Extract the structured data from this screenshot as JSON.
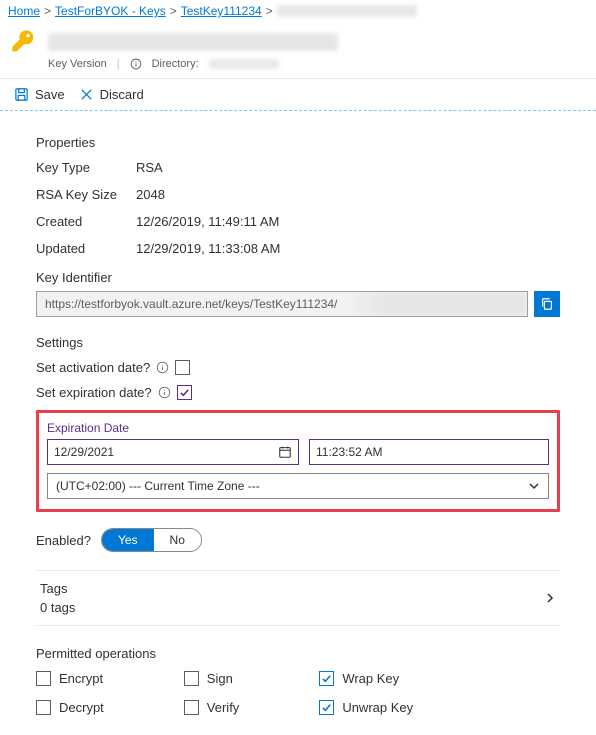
{
  "breadcrumb": {
    "home": "Home",
    "vault": "TestForBYOK - Keys",
    "key": "TestKey111234"
  },
  "header": {
    "subtitle": "Key Version",
    "directory_label": "Directory:"
  },
  "toolbar": {
    "save": "Save",
    "discard": "Discard"
  },
  "properties": {
    "heading": "Properties",
    "key_type_label": "Key Type",
    "key_type": "RSA",
    "rsa_size_label": "RSA Key Size",
    "rsa_size": "2048",
    "created_label": "Created",
    "created": "12/26/2019, 11:49:11 AM",
    "updated_label": "Updated",
    "updated": "12/29/2019, 11:33:08 AM",
    "identifier_label": "Key Identifier",
    "identifier": "https://testforbyok.vault.azure.net/keys/TestKey111234/"
  },
  "settings": {
    "heading": "Settings",
    "activation_label": "Set activation date?",
    "activation_checked": false,
    "expiration_label": "Set expiration date?",
    "expiration_checked": true,
    "exp_section": {
      "label": "Expiration Date",
      "date": "12/29/2021",
      "time": "11:23:52 AM",
      "timezone": "(UTC+02:00) --- Current Time Zone ---"
    },
    "enabled_label": "Enabled?",
    "enabled_yes": "Yes",
    "enabled_no": "No",
    "enabled_value": true
  },
  "tags": {
    "label": "Tags",
    "count_text": "0 tags"
  },
  "permitted": {
    "heading": "Permitted operations",
    "ops": {
      "encrypt": {
        "label": "Encrypt",
        "checked": false
      },
      "decrypt": {
        "label": "Decrypt",
        "checked": false
      },
      "sign": {
        "label": "Sign",
        "checked": false
      },
      "verify": {
        "label": "Verify",
        "checked": false
      },
      "wrap": {
        "label": "Wrap Key",
        "checked": true
      },
      "unwrap": {
        "label": "Unwrap Key",
        "checked": true
      }
    }
  }
}
